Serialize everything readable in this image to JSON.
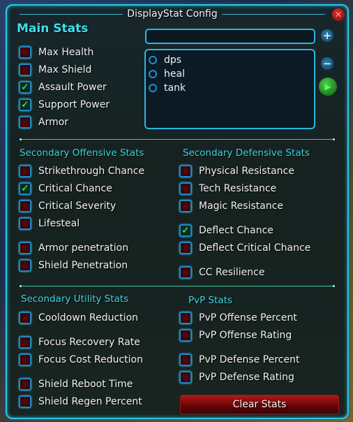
{
  "window": {
    "title": "DisplayStat Config"
  },
  "main_stats": {
    "heading": "Main Stats",
    "items": [
      {
        "label": "Max Health",
        "checked": false
      },
      {
        "label": "Max Shield",
        "checked": false
      },
      {
        "label": "Assault Power",
        "checked": true
      },
      {
        "label": "Support Power",
        "checked": true
      },
      {
        "label": "Armor",
        "checked": false
      }
    ]
  },
  "profile": {
    "name_value": "",
    "options": [
      {
        "label": "dps",
        "selected": false
      },
      {
        "label": "heal",
        "selected": false
      },
      {
        "label": "tank",
        "selected": false
      }
    ],
    "add_icon": "+",
    "remove_icon": "−",
    "apply_icon": "▶"
  },
  "offensive": {
    "heading": "Secondary Offensive Stats",
    "items": [
      {
        "label": "Strikethrough Chance",
        "checked": false
      },
      {
        "label": "Critical Chance",
        "checked": true
      },
      {
        "label": "Critical Severity",
        "checked": false
      },
      {
        "label": "Lifesteal",
        "checked": false
      },
      {
        "label": "Armor penetration",
        "checked": false
      },
      {
        "label": "Shield Penetration",
        "checked": false
      }
    ]
  },
  "defensive": {
    "heading": "Secondary Defensive Stats",
    "items": [
      {
        "label": "Physical Resistance",
        "checked": false
      },
      {
        "label": "Tech Resistance",
        "checked": false
      },
      {
        "label": "Magic Resistance",
        "checked": false
      },
      {
        "label": "Deflect Chance",
        "checked": true
      },
      {
        "label": "Deflect Critical Chance",
        "checked": false
      },
      {
        "label": "CC Resilience",
        "checked": false
      }
    ]
  },
  "utility": {
    "heading": "Secondary Utility Stats",
    "items": [
      {
        "label": "Cooldown Reduction",
        "checked": false
      },
      {
        "label": "Focus Recovery Rate",
        "checked": false
      },
      {
        "label": "Focus Cost Reduction",
        "checked": false
      },
      {
        "label": "Shield Reboot Time",
        "checked": false
      },
      {
        "label": "Shield Regen Percent",
        "checked": false
      }
    ]
  },
  "pvp": {
    "heading": "PvP Stats",
    "items": [
      {
        "label": "PvP Offense Percent",
        "checked": false
      },
      {
        "label": "PvP Offense Rating",
        "checked": false
      },
      {
        "label": "PvP Defense Percent",
        "checked": false
      },
      {
        "label": "PvP Defense Rating",
        "checked": false
      }
    ]
  },
  "buttons": {
    "clear_label": "Clear Stats",
    "close_icon": "✕"
  },
  "check_glyph": "✓"
}
